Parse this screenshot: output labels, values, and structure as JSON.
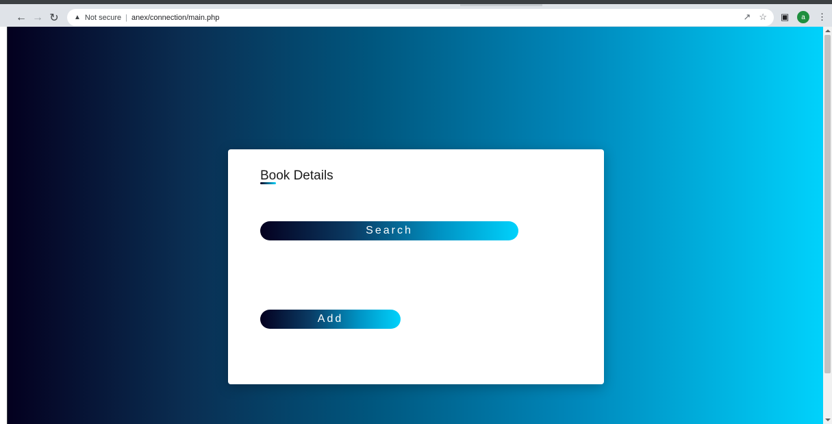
{
  "browser": {
    "security_label": "Not secure",
    "url": "anex/connection/main.php",
    "profile_initial": "a"
  },
  "page": {
    "title": "Book Details",
    "search_label": "Search",
    "add_label": "Add"
  },
  "colors": {
    "gradient_start": "#04001f",
    "gradient_end": "#00d2fc"
  }
}
